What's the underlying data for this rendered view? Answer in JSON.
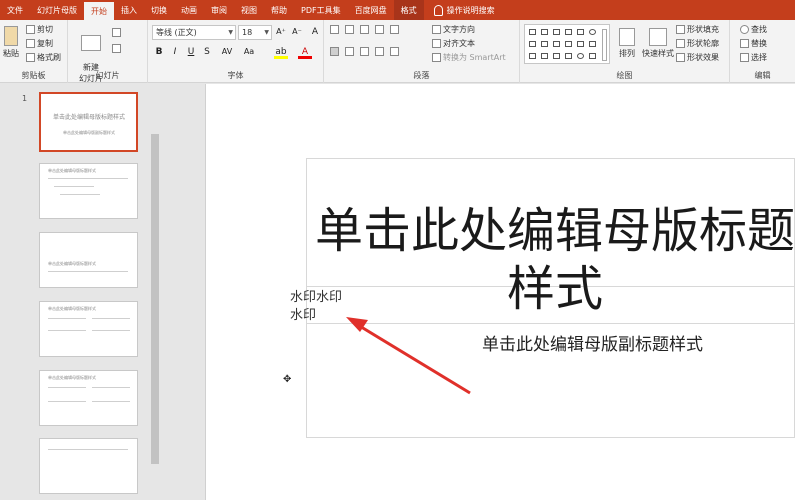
{
  "ribbon_tabs": [
    "文件",
    "幻灯片母版",
    "开始",
    "插入",
    "切换",
    "动画",
    "审阅",
    "视图",
    "帮助",
    "PDF工具集",
    "百度网盘",
    "格式"
  ],
  "active_tab": "开始",
  "tell_me": "操作说明搜索",
  "clipboard": {
    "paste": "粘贴",
    "cut": "剪切",
    "copy": "复制",
    "format_painter": "格式刷",
    "label": "剪贴板"
  },
  "slides_group": {
    "new_slide": "新建\n幻灯片",
    "label": "幻灯片"
  },
  "font_group": {
    "font_name": "等线 (正文)",
    "font_size": "18",
    "bold": "B",
    "italic": "I",
    "underline": "U",
    "strike": "S",
    "label": "字体"
  },
  "paragraph_group": {
    "text_direction": "文字方向",
    "align_text": "对齐文本",
    "smartart": "转换为 SmartArt",
    "label": "段落"
  },
  "drawing_group": {
    "arrange": "排列",
    "quick_styles": "快速样式",
    "shape_fill": "形状填充",
    "shape_outline": "形状轮廓",
    "shape_effects": "形状效果",
    "label": "绘图"
  },
  "editing_group": {
    "find": "查找",
    "replace": "替换",
    "select": "选择",
    "label": "编辑"
  },
  "thumbnails": [
    {
      "number": "1",
      "title": "单击此处编辑母版标题样式",
      "subtitle": "单击此处编辑母版副标题样式"
    },
    {
      "number": "",
      "title": "单击此处编辑母版标题样式"
    },
    {
      "number": "",
      "title": "单击此处编辑母版标题样式"
    },
    {
      "number": "",
      "title": "单击此处编辑母版标题样式"
    },
    {
      "number": "",
      "title": "单击此处编辑母版标题样式"
    },
    {
      "number": "",
      "title": ""
    }
  ],
  "slide": {
    "title": "单击此处编辑母版标题样式",
    "subtitle": "单击此处编辑母版副标题样式",
    "watermark": "水印水印水印"
  },
  "colors": {
    "accent": "#c43e1c",
    "arrow": "#e0302a",
    "selection": "#d24726"
  }
}
